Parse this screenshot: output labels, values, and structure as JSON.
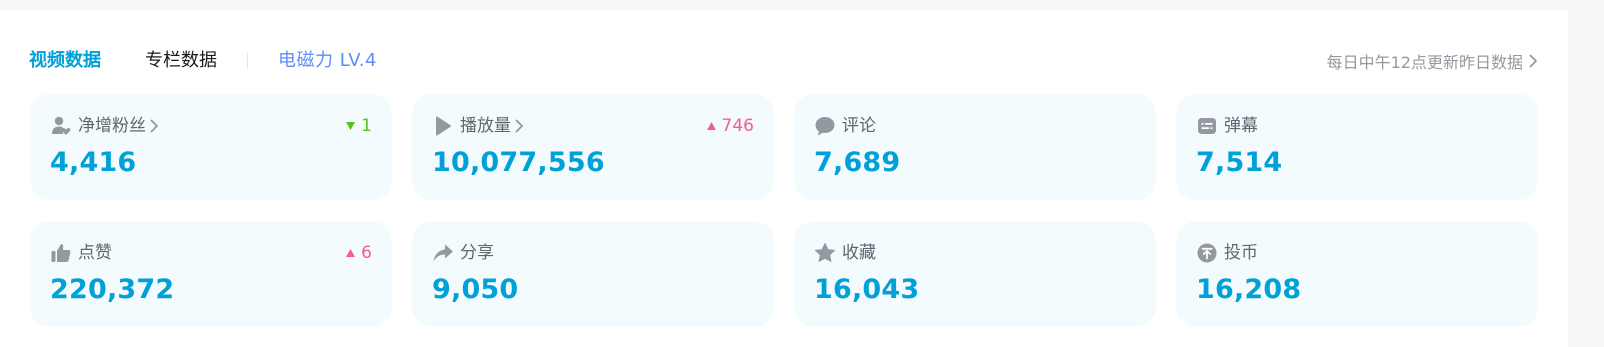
{
  "tabs": {
    "video": "视频数据",
    "column": "专栏数据"
  },
  "level": "电磁力 LV.4",
  "update_note": "每日中午12点更新昨日数据",
  "colors": {
    "accent": "#00a1d6",
    "level": "#5f8cf7",
    "up": "#f25d8e",
    "down": "#52c41a",
    "card_bg": "#f3fbfe",
    "icon": "#9499a0"
  },
  "cards": [
    {
      "label": "净增粉丝",
      "value": "4,416",
      "icon": "fans-icon",
      "has_link": true,
      "delta": "1",
      "delta_dir": "down"
    },
    {
      "label": "播放量",
      "value": "10,077,556",
      "icon": "play-icon",
      "has_link": true,
      "delta": "746",
      "delta_dir": "up"
    },
    {
      "label": "评论",
      "value": "7,689",
      "icon": "comment-icon",
      "has_link": false,
      "delta": "",
      "delta_dir": ""
    },
    {
      "label": "弹幕",
      "value": "7,514",
      "icon": "danmaku-icon",
      "has_link": false,
      "delta": "",
      "delta_dir": ""
    },
    {
      "label": "点赞",
      "value": "220,372",
      "icon": "like-icon",
      "has_link": false,
      "delta": "6",
      "delta_dir": "up"
    },
    {
      "label": "分享",
      "value": "9,050",
      "icon": "share-icon",
      "has_link": false,
      "delta": "",
      "delta_dir": ""
    },
    {
      "label": "收藏",
      "value": "16,043",
      "icon": "favorite-icon",
      "has_link": false,
      "delta": "",
      "delta_dir": ""
    },
    {
      "label": "投币",
      "value": "16,208",
      "icon": "coin-icon",
      "has_link": false,
      "delta": "",
      "delta_dir": ""
    }
  ]
}
